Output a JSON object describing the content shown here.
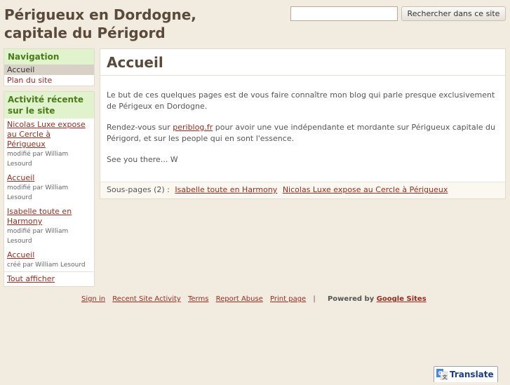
{
  "site": {
    "title_line1": "Périgueux en Dordogne,",
    "title_line2": "capitale du Périgord"
  },
  "search": {
    "value": "",
    "placeholder": "",
    "button_label": "Rechercher dans ce site"
  },
  "navigation": {
    "heading": "Navigation",
    "items": [
      {
        "label": "Accueil",
        "current": true
      },
      {
        "label": "Plan du site",
        "current": false
      }
    ]
  },
  "activity": {
    "heading": "Activité récente sur le site",
    "entries": [
      {
        "link": "Nicolas Luxe expose au Cercle à Périgueux",
        "meta": "modifié par William Lesourd"
      },
      {
        "link": "Accueil",
        "meta": "modifié par William Lesourd"
      },
      {
        "link": "Isabelle toute en Harmony",
        "meta": "modifié par William Lesourd"
      },
      {
        "link": "Accueil",
        "meta": "créé par William Lesourd"
      }
    ],
    "show_all": "Tout afficher"
  },
  "page": {
    "title": "Accueil",
    "p1": "Le but de ces quelques pages est de vous faire connaître mon blog qui parle presque exclusivement de Périgeux en Dordogne.",
    "p2_before": "Rendez-vous sur ",
    "p2_link": "periblog.fr",
    "p2_after": " pour avoir une vue indépendante et mordante sur Périgueux capitale du Périgord, et sur les people qui en sont l'essence.",
    "p3": "See you there... W",
    "subpages_label": "Sous-pages (2) :",
    "subpages": [
      "Isabelle toute en Harmony",
      "Nicolas Luxe expose au Cercle à Périgueux"
    ]
  },
  "footer": {
    "links": [
      "Sign in",
      "Recent Site Activity",
      "Terms",
      "Report Abuse",
      "Print page"
    ],
    "separator": "|",
    "powered_prefix": "Powered by ",
    "powered_link": "Google Sites"
  },
  "translate": {
    "label": "Translate",
    "icon": "google-translate-icon"
  }
}
